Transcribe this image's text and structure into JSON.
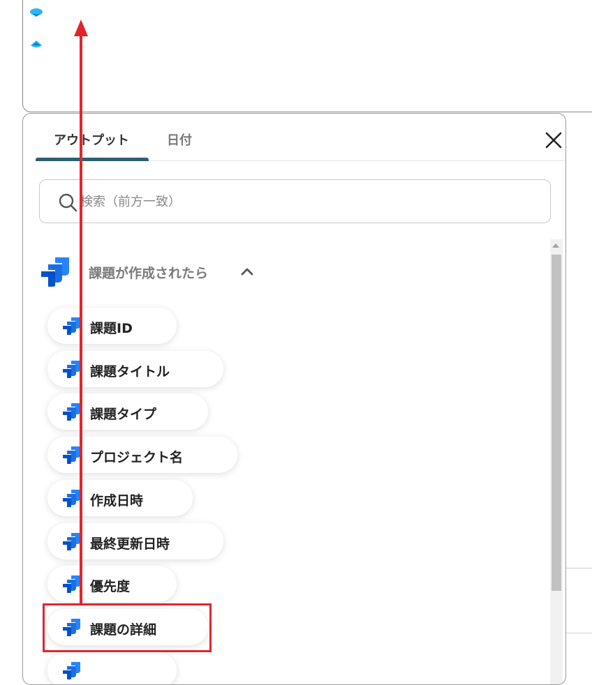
{
  "tabs": [
    {
      "label": "アウトプット",
      "active": true
    },
    {
      "label": "日付",
      "active": false
    }
  ],
  "search": {
    "placeholder": "検索（前方一致）",
    "value": ""
  },
  "group": {
    "title": "課題が作成されたら",
    "icon": "jira-logo-icon",
    "expanded": true
  },
  "items": [
    {
      "label": "課題ID"
    },
    {
      "label": "課題タイトル"
    },
    {
      "label": "課題タイプ"
    },
    {
      "label": "プロジェクト名"
    },
    {
      "label": "作成日時"
    },
    {
      "label": "最終更新日時"
    },
    {
      "label": "優先度"
    },
    {
      "label": "課題の詳細"
    },
    {
      "label": ""
    }
  ],
  "icons": {
    "close": "close-icon",
    "search": "search-icon",
    "chevron": "chevron-up-icon",
    "item": "jira-logo-icon"
  },
  "colors": {
    "tab_underline": "#2d5f74",
    "annotation": "#e0262b",
    "jira_blue": "#2684ff"
  }
}
